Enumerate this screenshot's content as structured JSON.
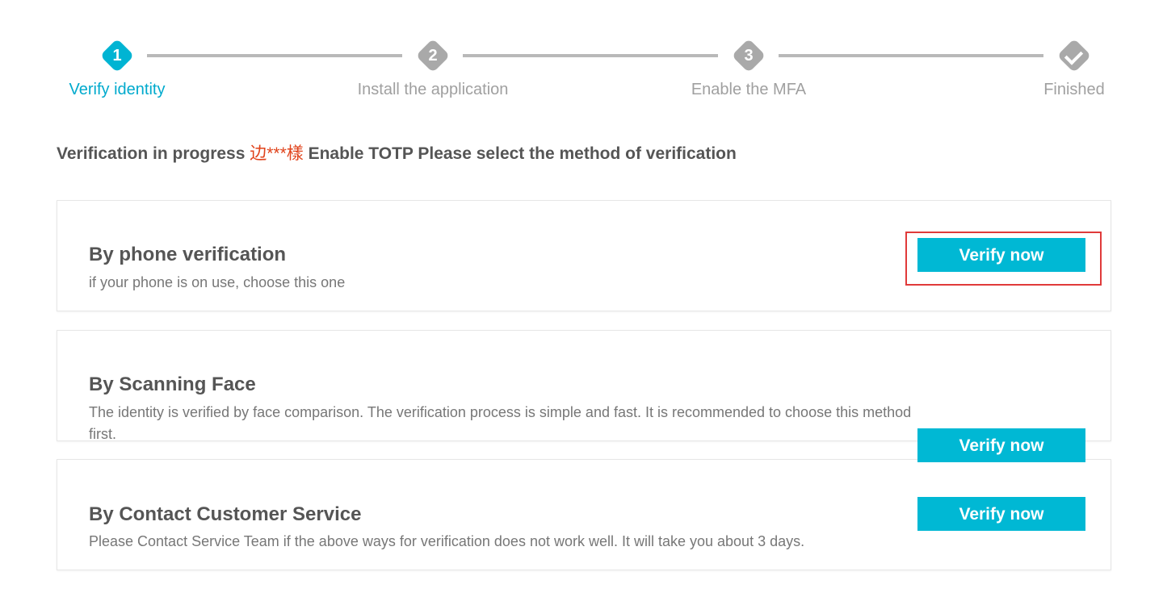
{
  "stepper": {
    "steps": [
      {
        "number": "1",
        "label": "Verify identity",
        "state": "active"
      },
      {
        "number": "2",
        "label": "Install the application",
        "state": "pending"
      },
      {
        "number": "3",
        "label": "Enable the MFA",
        "state": "pending"
      },
      {
        "number": "",
        "label": "Finished",
        "state": "pending",
        "icon": "check-icon"
      }
    ]
  },
  "heading": {
    "prefix": "Verification in progress ",
    "masked_user": "边***樣",
    "suffix": " Enable TOTP Please select the method of verification"
  },
  "methods": [
    {
      "title": "By phone verification",
      "description": "if your phone is on use, choose this one",
      "button_label": "Verify now"
    },
    {
      "title": "By Scanning Face",
      "description": "The identity is verified by face comparison. The verification process is simple and fast. It is recommended to choose this method first.",
      "button_label": "Verify now"
    },
    {
      "title": "By Contact Customer Service",
      "description": "Please Contact Service Team if the above ways for verification does not work well. It will take you about 3 days.",
      "button_label": "Verify now"
    }
  ],
  "colors": {
    "accent": "#00b8d4",
    "active_step": "#00b4d3",
    "inactive_step": "#a9a9a9",
    "masked_name": "#e0431b",
    "highlight": "#e03a3a"
  }
}
